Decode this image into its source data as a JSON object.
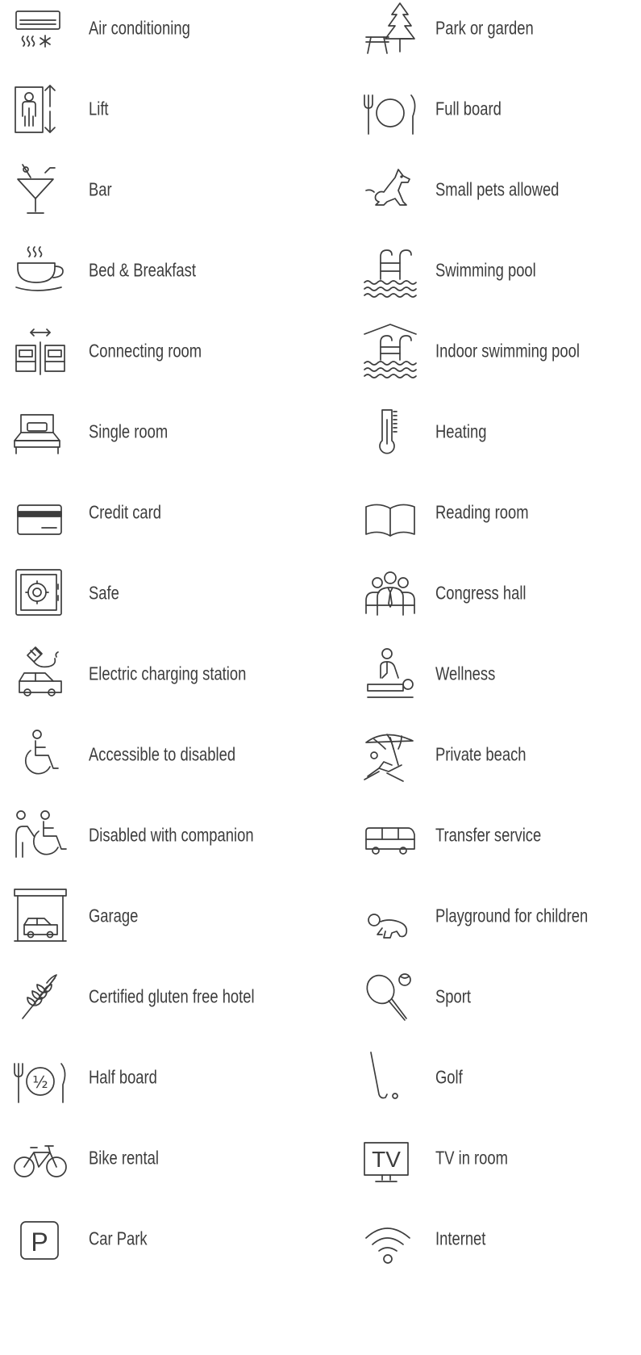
{
  "left": [
    {
      "label": "Air conditioning",
      "icon": "air-conditioning-icon"
    },
    {
      "label": "Lift",
      "icon": "lift-icon"
    },
    {
      "label": "Bar",
      "icon": "cocktail-icon"
    },
    {
      "label": "Bed & Breakfast",
      "icon": "coffee-cup-icon"
    },
    {
      "label": "Connecting room",
      "icon": "connecting-room-icon"
    },
    {
      "label": "Single room",
      "icon": "single-bed-icon"
    },
    {
      "label": "Credit card",
      "icon": "credit-card-icon"
    },
    {
      "label": "Safe",
      "icon": "safe-icon"
    },
    {
      "label": "Electric charging station",
      "icon": "electric-charging-icon"
    },
    {
      "label": "Accessible to disabled",
      "icon": "wheelchair-icon"
    },
    {
      "label": "Disabled with companion",
      "icon": "wheelchair-companion-icon"
    },
    {
      "label": "Garage",
      "icon": "garage-icon"
    },
    {
      "label": "Certified gluten free hotel",
      "icon": "wheat-icon"
    },
    {
      "label": "Half board",
      "icon": "half-board-icon"
    },
    {
      "label": "Bike rental",
      "icon": "bicycle-icon"
    },
    {
      "label": "Car Park",
      "icon": "parking-icon"
    }
  ],
  "right": [
    {
      "label": "Park or garden",
      "icon": "park-icon"
    },
    {
      "label": "Full board",
      "icon": "full-board-icon"
    },
    {
      "label": "Small pets allowed",
      "icon": "dog-icon"
    },
    {
      "label": "Swimming pool",
      "icon": "swimming-pool-icon"
    },
    {
      "label": "Indoor swimming pool",
      "icon": "indoor-pool-icon"
    },
    {
      "label": "Heating",
      "icon": "thermometer-icon"
    },
    {
      "label": "Reading room",
      "icon": "open-book-icon"
    },
    {
      "label": "Congress hall",
      "icon": "congress-hall-icon"
    },
    {
      "label": "Wellness",
      "icon": "massage-icon"
    },
    {
      "label": "Private beach",
      "icon": "beach-umbrella-icon"
    },
    {
      "label": "Transfer service",
      "icon": "bus-icon"
    },
    {
      "label": "Playground for children",
      "icon": "baby-crawling-icon"
    },
    {
      "label": "Sport",
      "icon": "tennis-racket-icon"
    },
    {
      "label": "Golf",
      "icon": "golf-club-icon"
    },
    {
      "label": "TV in room",
      "icon": "tv-icon"
    },
    {
      "label": "Internet",
      "icon": "wifi-icon"
    }
  ],
  "icon_text": {
    "half": "½",
    "tv": "TV",
    "parking": "P"
  }
}
